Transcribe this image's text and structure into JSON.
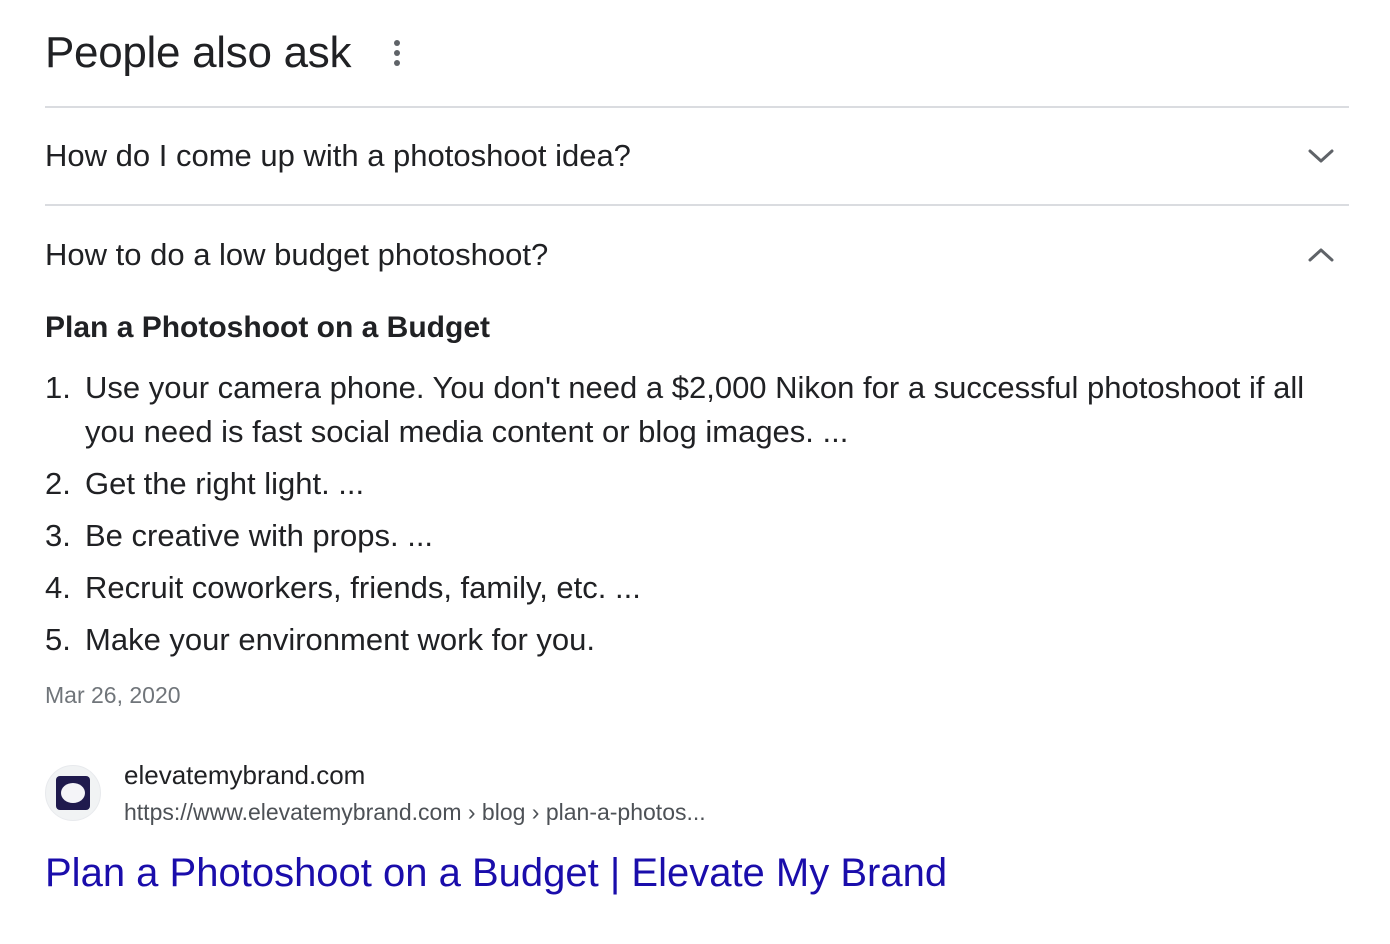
{
  "paa": {
    "title": "People also ask",
    "more_icon": "more-vert-icon"
  },
  "questions": [
    {
      "text": "How do I come up with a photoshoot idea?",
      "expanded": false,
      "icon": "chevron-down-icon"
    },
    {
      "text": "How to do a low budget photoshoot?",
      "expanded": true,
      "icon": "chevron-up-icon"
    }
  ],
  "answer": {
    "heading": "Plan a Photoshoot on a Budget",
    "items": [
      {
        "num": "1.",
        "text": "Use your camera phone. You don't need a $2,000 Nikon for a successful photoshoot if all you need is fast social media content or blog images. ..."
      },
      {
        "num": "2.",
        "text": "Get the right light. ..."
      },
      {
        "num": "3.",
        "text": "Be creative with props. ..."
      },
      {
        "num": "4.",
        "text": "Recruit coworkers, friends, family, etc. ..."
      },
      {
        "num": "5.",
        "text": "Make your environment work for you."
      }
    ],
    "date": "Mar 26, 2020"
  },
  "source": {
    "site_name": "elevatemybrand.com",
    "url": "https://www.elevatemybrand.com › blog › plan-a-photos...",
    "link_title": "Plan a Photoshoot on a Budget | Elevate My Brand",
    "favicon_color": "#1f1a4d",
    "link_color": "#1a0dab"
  }
}
